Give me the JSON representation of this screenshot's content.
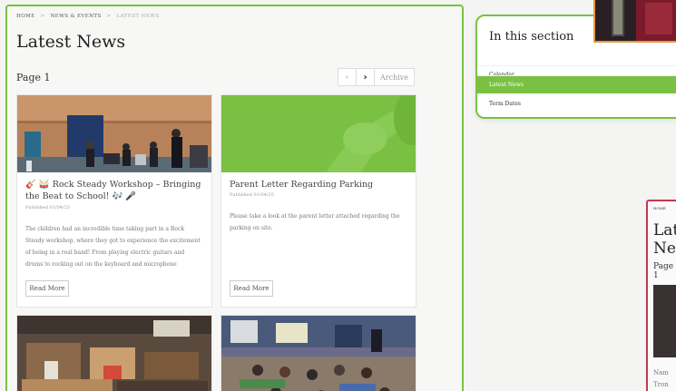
{
  "breadcrumb": {
    "home": "HOME",
    "section": "NEWS & EVENTS",
    "current": "LATEST NEWS",
    "separator": ">"
  },
  "page_title": "Latest News",
  "page_label": "Page 1",
  "pager": {
    "prev": "‹",
    "next": "›",
    "archive": "Archive"
  },
  "cards": [
    {
      "title": "🎸 🥁 Rock Steady Workshop – Bringing the Beat to School! 🎶 🎤",
      "date": "Published 01/04/25",
      "description": "The children had an incredible time taking part in a Rock Steady workshop, where they got to experience the excitement of being in a real band! From playing electric guitars and drums to rocking out on the keyboard and microphone",
      "read_more": "Read More"
    },
    {
      "title": "Parent Letter Regarding Parking",
      "date": "Published 01/04/25",
      "description": "Please take a look at the parent letter attached regarding the parking on site.",
      "read_more": "Read More"
    }
  ],
  "side_panel": {
    "heading": "In this section",
    "items": [
      "Calendar",
      "Latest News",
      "Term Dates"
    ]
  },
  "mini_preview": {
    "crumb": "HOME",
    "title": "Latest News",
    "page": "Page 1",
    "text": "Nam Tron"
  },
  "colors": {
    "accent": "#7ac143",
    "highlight_orange": "#e39a3c",
    "highlight_red": "#c23a4a"
  }
}
